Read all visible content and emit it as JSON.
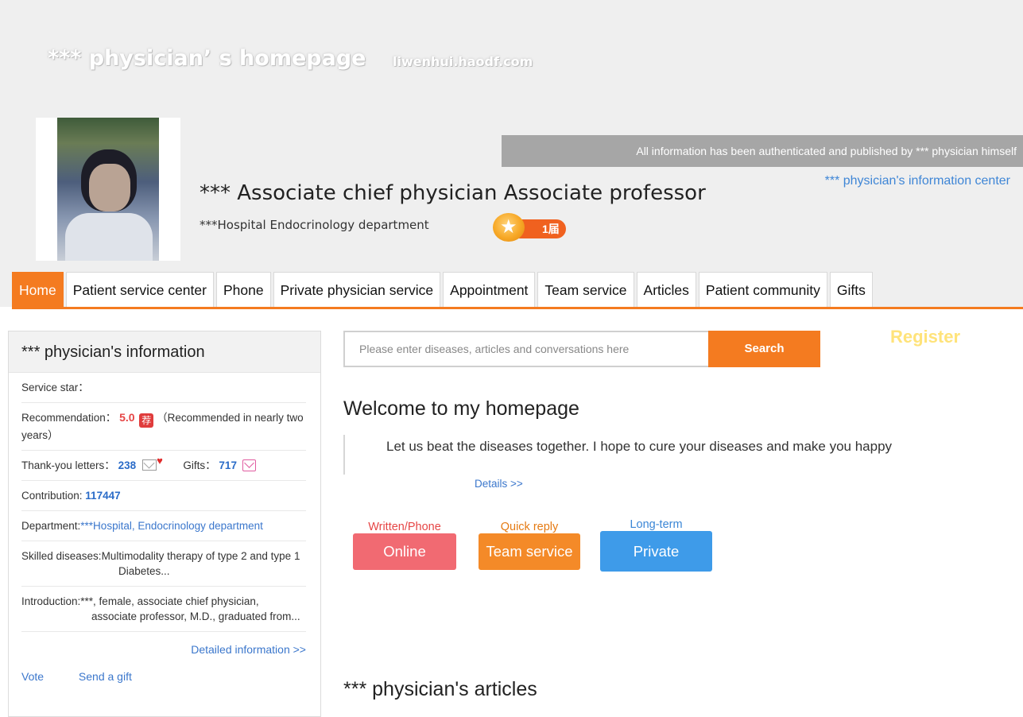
{
  "header": {
    "site_title": "*** physician’ s homepage",
    "domain": "liwenhui.haodf.com",
    "auth_notice": "All information has been authenticated and published by *** physician himself",
    "info_center_link": "*** physician's information center",
    "doctor_title": "***  Associate chief physician Associate professor",
    "hospital_dept": "***Hospital  Endocrinology department",
    "badge_text": "1届"
  },
  "nav": {
    "tabs": [
      {
        "label": "Home",
        "active": true
      },
      {
        "label": "Patient service center"
      },
      {
        "label": "Phone"
      },
      {
        "label": "Private physician service"
      },
      {
        "label": "Appointment"
      },
      {
        "label": "Team service"
      },
      {
        "label": "Articles"
      },
      {
        "label": "Patient community"
      },
      {
        "label": "Gifts"
      }
    ]
  },
  "sidebar": {
    "heading": "*** physician's information",
    "service_star_label": "Service star：",
    "recommendation_label": "Recommendation：",
    "recommendation_value": "5.0",
    "recommendation_icon": "荐",
    "recommendation_note": "（Recommended in nearly two years）",
    "thanks_label": "Thank-you letters：",
    "thanks_value": "238",
    "gifts_label": "Gifts：",
    "gifts_value": "717",
    "contribution_label": "Contribution: ",
    "contribution_value": "117447",
    "department_label": "Department:",
    "department_value": "***Hospital, Endocrinology department",
    "skilled_label": "Skilled diseases:",
    "skilled_value": "Multimodality therapy of type 2 and type 1 Diabetes...",
    "intro_label": "Introduction:",
    "intro_value": "***, female, associate chief physician, associate professor, M.D., graduated from...",
    "detail_link": "Detailed information >>",
    "vote": "Vote",
    "send_gift": "Send a gift"
  },
  "search": {
    "placeholder": "Please enter diseases, articles and conversations here",
    "button": "Search"
  },
  "register": "Register",
  "welcome": {
    "title": "Welcome to my homepage",
    "message": "Let us beat the diseases together. I hope to cure your diseases and make you happy",
    "details_link": "Details >>"
  },
  "services": [
    {
      "caption": "Written/Phone",
      "label": "Online"
    },
    {
      "caption": "Quick reply",
      "label": "Team service"
    },
    {
      "caption": "Long-term",
      "label": "Private"
    }
  ],
  "articles_title": "*** physician's articles",
  "colors": {
    "accent": "#f47b20",
    "link": "#3b77cc",
    "online": "#f16a72",
    "team": "#f48a28",
    "private": "#3e9be9"
  },
  "icons": [
    "star-medal-icon",
    "recommend-icon",
    "thank-letter-icon",
    "gift-icon"
  ]
}
